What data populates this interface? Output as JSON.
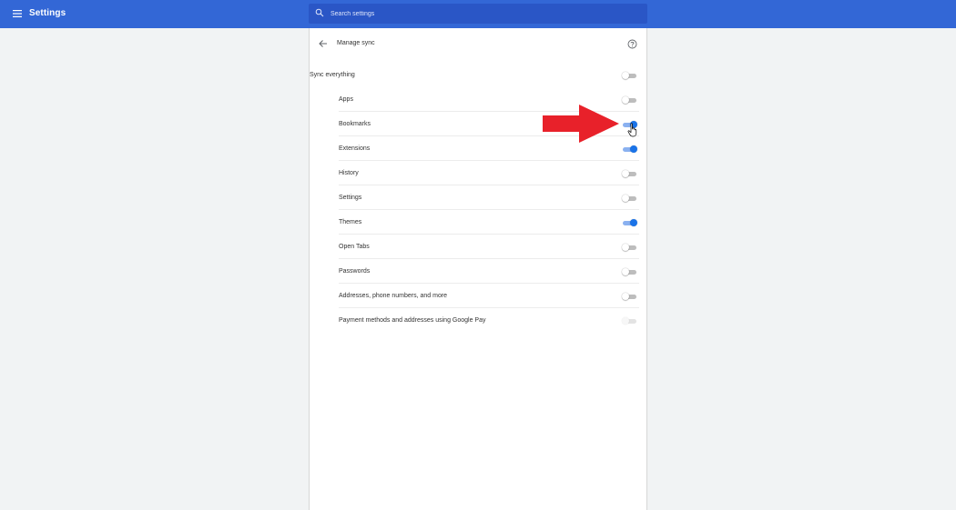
{
  "header": {
    "app_title": "Settings",
    "menu_icon": "hamburger-menu-icon",
    "search_icon": "search-icon",
    "search_placeholder": "Search settings",
    "background_color": "#3367d6",
    "search_background_color": "#2a56c6"
  },
  "page": {
    "title": "Manage sync",
    "back_icon": "arrow-left-icon",
    "help_icon": "help-circle-icon"
  },
  "sync_everything": {
    "label": "Sync everything",
    "enabled": false
  },
  "sync_items": [
    {
      "label": "Apps",
      "enabled": false,
      "disabled": false
    },
    {
      "label": "Bookmarks",
      "enabled": true,
      "disabled": false
    },
    {
      "label": "Extensions",
      "enabled": true,
      "disabled": false
    },
    {
      "label": "History",
      "enabled": false,
      "disabled": false
    },
    {
      "label": "Settings",
      "enabled": false,
      "disabled": false
    },
    {
      "label": "Themes",
      "enabled": true,
      "disabled": false
    },
    {
      "label": "Open Tabs",
      "enabled": false,
      "disabled": false
    },
    {
      "label": "Passwords",
      "enabled": false,
      "disabled": false
    },
    {
      "label": "Addresses, phone numbers, and more",
      "enabled": false,
      "disabled": false
    },
    {
      "label": "Payment methods and addresses using Google Pay",
      "enabled": false,
      "disabled": true
    }
  ],
  "colors": {
    "toggle_on": "#1a73e8",
    "toggle_on_track": "#8ab1f0",
    "toggle_off_track": "#bdbdbd",
    "annotation_arrow": "#e8212a"
  },
  "annotations": {
    "arrow_icon": "red-arrow-icon",
    "cursor_icon": "hand-pointer-icon"
  }
}
